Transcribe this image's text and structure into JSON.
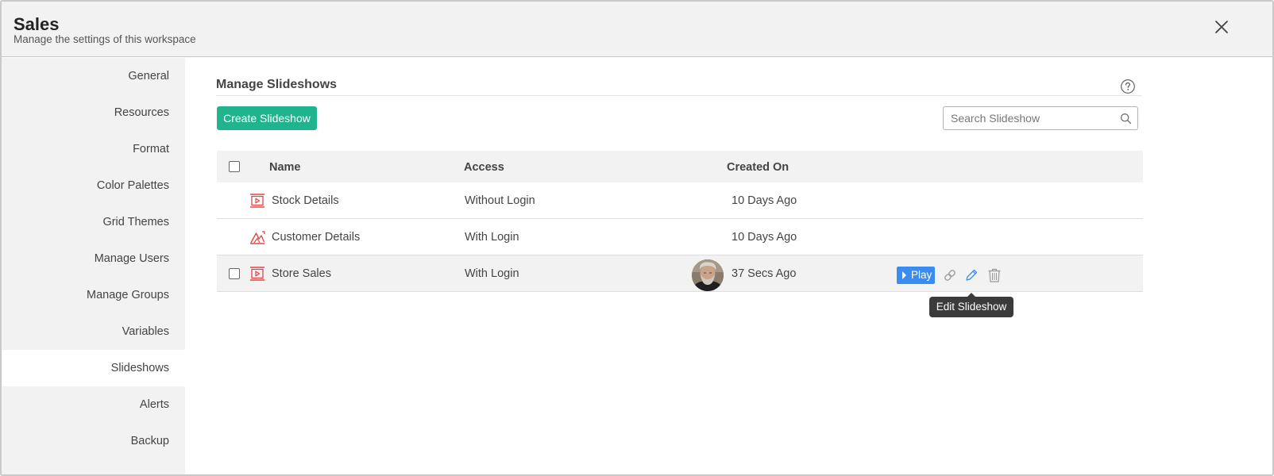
{
  "header": {
    "title": "Sales",
    "subtitle": "Manage the settings of this workspace",
    "close_icon": "close-icon"
  },
  "sidebar": {
    "items": [
      {
        "label": "General",
        "active": false
      },
      {
        "label": "Resources",
        "active": false
      },
      {
        "label": "Format",
        "active": false
      },
      {
        "label": "Color Palettes",
        "active": false
      },
      {
        "label": "Grid Themes",
        "active": false
      },
      {
        "label": "Manage Users",
        "active": false
      },
      {
        "label": "Manage Groups",
        "active": false
      },
      {
        "label": "Variables",
        "active": false
      },
      {
        "label": "Slideshows",
        "active": true
      },
      {
        "label": "Alerts",
        "active": false
      },
      {
        "label": "Backup",
        "active": false
      }
    ]
  },
  "main": {
    "section_title": "Manage Slideshows",
    "help_icon": "question-icon",
    "create_button": "Create Slideshow",
    "search": {
      "placeholder": "Search Slideshow",
      "value": "",
      "icon": "search-icon"
    },
    "table": {
      "columns": {
        "name": "Name",
        "access": "Access",
        "created_on": "Created On"
      },
      "rows": [
        {
          "name": "Stock Details",
          "access": "Without Login",
          "created_on": "10 Days Ago",
          "icon": "slideshow-icon"
        },
        {
          "name": "Customer Details",
          "access": "With Login",
          "created_on": "10 Days Ago",
          "icon": "chart-slideshow-icon"
        },
        {
          "name": "Store Sales",
          "access": "With Login",
          "created_on": "37 Secs Ago",
          "icon": "slideshow-icon",
          "hovered": true
        }
      ]
    },
    "row_actions": {
      "play_label": "Play",
      "icons": [
        "link-icon",
        "pencil-icon",
        "trash-icon"
      ]
    },
    "tooltip": "Edit Slideshow"
  },
  "colors": {
    "accent_green": "#1fb38e",
    "play_blue": "#3a8df0",
    "icon_red": "#e04848",
    "edit_blue": "#3a8df0",
    "header_bg": "#f2f2f2"
  }
}
